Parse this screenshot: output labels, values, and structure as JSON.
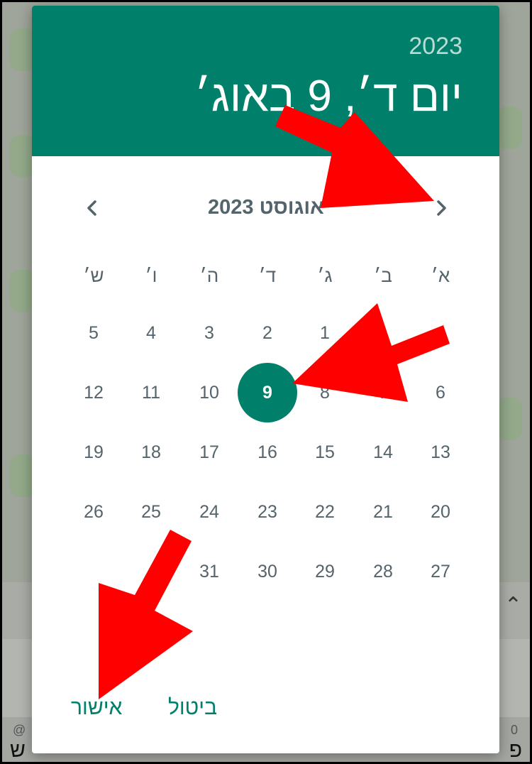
{
  "header": {
    "year": "2023",
    "date_label": "יום ד׳, 9 באוג׳"
  },
  "navigation": {
    "month_label": "אוגוסט 2023",
    "prev_icon": "chevron-left-icon",
    "next_icon": "chevron-right-icon"
  },
  "weekdays": [
    "א׳",
    "ב׳",
    "ג׳",
    "ד׳",
    "ה׳",
    "ו׳",
    "ש׳"
  ],
  "weeks": [
    [
      "",
      "",
      "1",
      "2",
      "3",
      "4",
      "5"
    ],
    [
      "6",
      "7",
      "8",
      "9",
      "10",
      "11",
      "12"
    ],
    [
      "13",
      "14",
      "15",
      "16",
      "17",
      "18",
      "19"
    ],
    [
      "20",
      "21",
      "22",
      "23",
      "24",
      "25",
      "26"
    ],
    [
      "27",
      "28",
      "29",
      "30",
      "31",
      "",
      ""
    ]
  ],
  "selected_day": "9",
  "actions": {
    "cancel_label": "ביטול",
    "ok_label": "אישור"
  },
  "background": {
    "at_label": "@",
    "zero_label": "0",
    "key_left": "ש",
    "key_right": "פ"
  },
  "colors": {
    "accent": "#00806a",
    "annotation_arrow": "#ff0000",
    "text_muted": "#55636b"
  }
}
